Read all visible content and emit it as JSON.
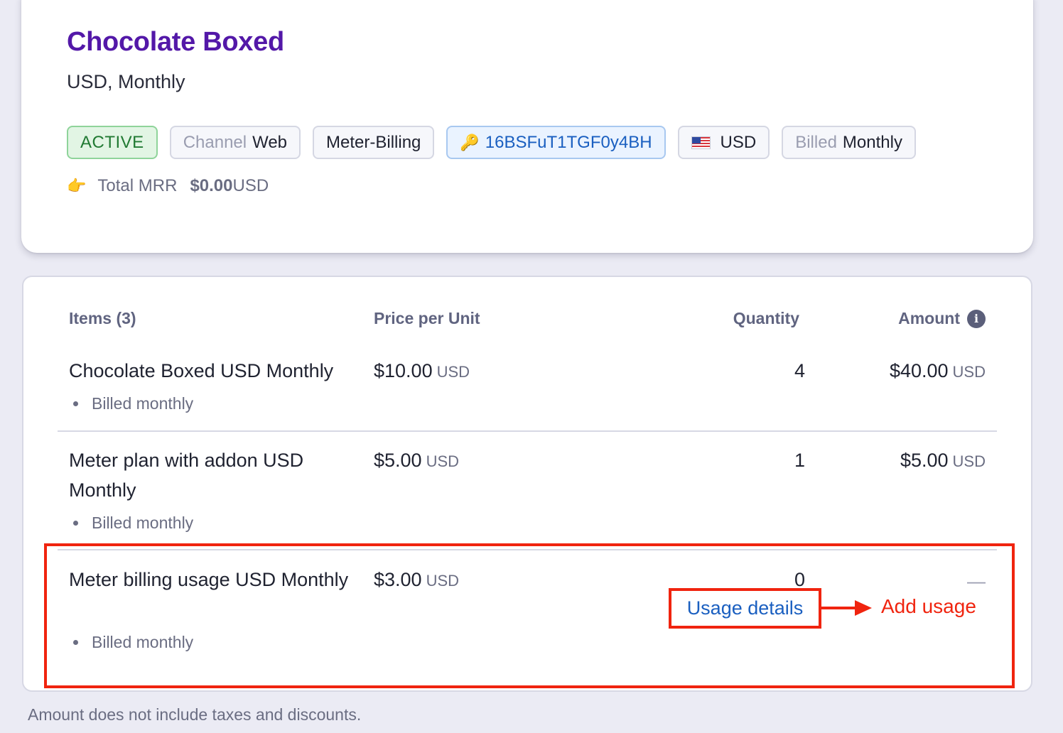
{
  "plan": {
    "title": "Chocolate Boxed",
    "subtitle": "USD, Monthly",
    "tags": {
      "status": "ACTIVE",
      "channel_label": "Channel",
      "channel_value": "Web",
      "type": "Meter-Billing",
      "key_id": "16BSFuT1TGF0y4BH",
      "currency": "USD",
      "billed_label": "Billed",
      "billed_value": "Monthly"
    },
    "mrr": {
      "label": "Total MRR",
      "amount": "$0.00",
      "currency": "USD"
    }
  },
  "items_table": {
    "headers": {
      "items": "Items (3)",
      "price": "Price per Unit",
      "quantity": "Quantity",
      "amount": "Amount"
    },
    "rows": [
      {
        "name": "Chocolate Boxed USD Monthly",
        "price": "$10.00",
        "price_currency": "USD",
        "quantity": "4",
        "amount": "$40.00",
        "amount_currency": "USD",
        "billing": "Billed monthly"
      },
      {
        "name": "Meter plan with addon USD Monthly",
        "price": "$5.00",
        "price_currency": "USD",
        "quantity": "1",
        "amount": "$5.00",
        "amount_currency": "USD",
        "billing": "Billed monthly"
      },
      {
        "name": "Meter billing usage USD Monthly",
        "price": "$3.00",
        "price_currency": "USD",
        "quantity": "0",
        "amount": "—",
        "billing": "Billed monthly",
        "usage_link": "Usage details"
      }
    ]
  },
  "annotation": {
    "add_usage": "Add usage",
    "color": "#f0240f"
  },
  "footnote": "Amount does not include taxes and discounts.",
  "colors": {
    "title": "#5318a8",
    "link": "#1a5fc0",
    "active_bg": "#e2f5e4",
    "active_text": "#217a33"
  }
}
